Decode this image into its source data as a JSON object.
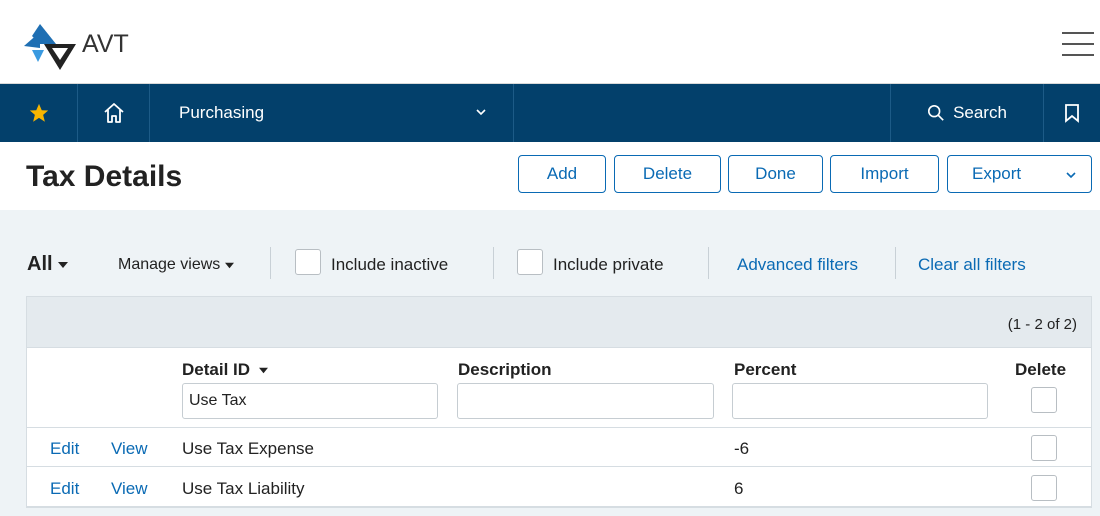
{
  "app": {
    "name": "AVT"
  },
  "nav": {
    "module": "Purchasing",
    "search_label": "Search"
  },
  "page": {
    "title": "Tax Details",
    "buttons": {
      "add": "Add",
      "delete": "Delete",
      "done": "Done",
      "import": "Import",
      "export": "Export"
    }
  },
  "filters": {
    "view": "All",
    "manage_views": "Manage views",
    "include_inactive": "Include inactive",
    "include_private": "Include private",
    "advanced_filters": "Advanced filters",
    "clear_all_filters": "Clear all filters"
  },
  "grid": {
    "count": "(1 - 2 of 2)",
    "columns": {
      "detail_id": "Detail ID",
      "description": "Description",
      "percent": "Percent",
      "delete": "Delete"
    },
    "column_filters": {
      "detail_id": "Use Tax",
      "description": "",
      "percent": ""
    },
    "rows": [
      {
        "edit": "Edit",
        "view": "View",
        "detail_id": "Use Tax Expense",
        "description": "",
        "percent": "-6",
        "delete": false
      },
      {
        "edit": "Edit",
        "view": "View",
        "detail_id": "Use Tax Liability",
        "description": "",
        "percent": "6",
        "delete": false
      }
    ]
  },
  "icons": {
    "star": "star-icon",
    "home": "home-icon",
    "chevron": "chevron-down-icon",
    "search": "search-icon",
    "bookmark": "bookmark-icon",
    "menu": "hamburger-menu-icon"
  },
  "colors": {
    "nav_background": "#03406b",
    "star": "#f7b500",
    "link": "#0a6ab4",
    "filter_background": "#eef3f6"
  }
}
